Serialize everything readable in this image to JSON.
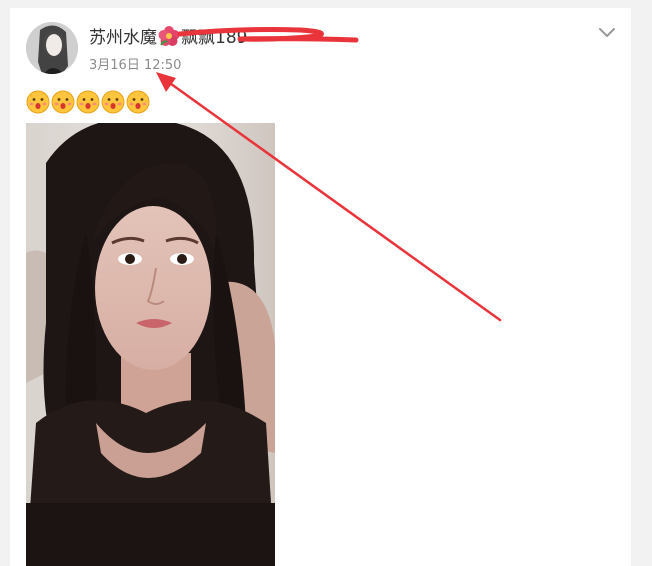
{
  "post": {
    "username_prefix": "苏州水魔",
    "username_suffix": "飘飘189",
    "timestamp": "3月16日 12:50",
    "emoji_count": 5,
    "emoji_icon": "surprised-face-icon",
    "flower_icon": "hibiscus-icon",
    "menu_icon": "chevron-down-icon"
  },
  "colors": {
    "card_bg": "#ffffff",
    "page_bg": "#f2f2f2",
    "annotation_red": "#e8343a",
    "timestamp_gray": "#8b8b8b",
    "username_text": "#333333"
  }
}
